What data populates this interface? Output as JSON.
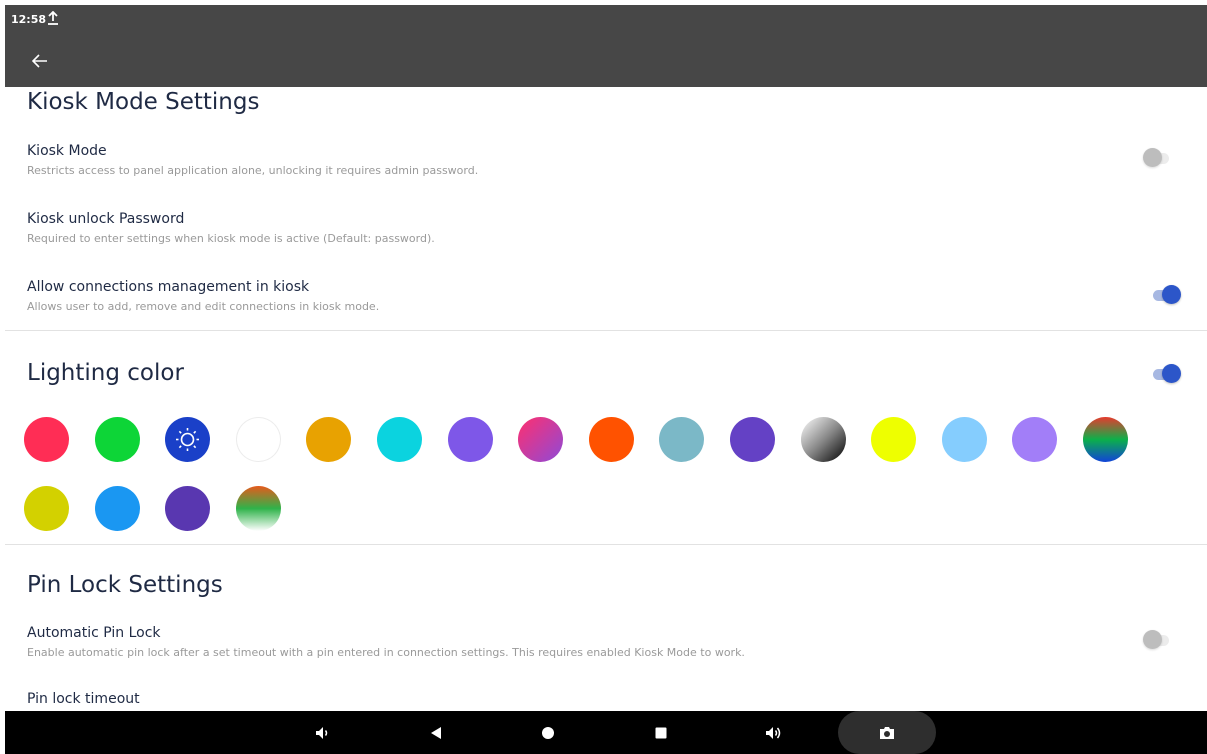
{
  "status_bar": {
    "time": "12:58",
    "upload_icon": "upload-icon"
  },
  "app_bar": {
    "back_icon": "arrow-left-icon"
  },
  "kiosk": {
    "title": "Kiosk Mode Settings",
    "items": [
      {
        "title": "Kiosk Mode",
        "summary": "Restricts access to panel application alone, unlocking it requires admin password.",
        "switch": false
      },
      {
        "title": "Kiosk unlock Password",
        "summary": "Required to enter settings when kiosk mode is active (Default: password)."
      },
      {
        "title": "Allow connections management in kiosk",
        "summary": "Allows user to add, remove and edit connections in kiosk mode.",
        "switch": true
      }
    ]
  },
  "lighting": {
    "title": "Lighting color",
    "switch": true,
    "selected_index": 2,
    "selected_icon": "sun-icon",
    "colors": [
      {
        "fill": "#ff2d55"
      },
      {
        "fill": "#0dd537"
      },
      {
        "fill": "#1a40c8"
      },
      {
        "fill": "#ffffff"
      },
      {
        "fill": "#e8a201"
      },
      {
        "fill": "#0bd3df"
      },
      {
        "fill": "#7e57e8"
      },
      {
        "fill": "linear-gradient(135deg, #ff2f6e, #8e4ad8)"
      },
      {
        "fill": "#ff5200"
      },
      {
        "fill": "#7bb8c7"
      },
      {
        "fill": "#6441c5"
      },
      {
        "fill": "linear-gradient(135deg, #ffffff 0%, #8a8a8a 50%, #000000 100%)"
      },
      {
        "fill": "#eeff00"
      },
      {
        "fill": "#85cdfe"
      },
      {
        "fill": "#a27ef8"
      },
      {
        "fill": "linear-gradient(180deg, #e63b2e 0%, #0cb04a 50%, #1144d8 100%)"
      },
      {
        "fill": "#d3d100"
      },
      {
        "fill": "#1a97f2"
      },
      {
        "fill": "#5937b0"
      },
      {
        "fill": "linear-gradient(180deg, #e65a1c 0%, #2fb34a 50%, #ffffff 100%)"
      }
    ]
  },
  "pinlock": {
    "title": "Pin Lock Settings",
    "items": [
      {
        "title": "Automatic Pin Lock",
        "summary": "Enable automatic pin lock after a set timeout with a pin entered in connection settings. This requires enabled Kiosk Mode to work.",
        "switch": false
      },
      {
        "title": "Pin lock timeout"
      }
    ]
  },
  "nav_bar": {
    "icons": [
      "volume-down-icon",
      "back-triangle-icon",
      "home-circle-icon",
      "recents-square-icon",
      "volume-up-icon",
      "camera-icon"
    ]
  },
  "colors": {
    "app_bar": "#474747",
    "accent": "#2c56c9",
    "title_text": "#1f2a44",
    "summary_text": "#9a9a9a"
  }
}
